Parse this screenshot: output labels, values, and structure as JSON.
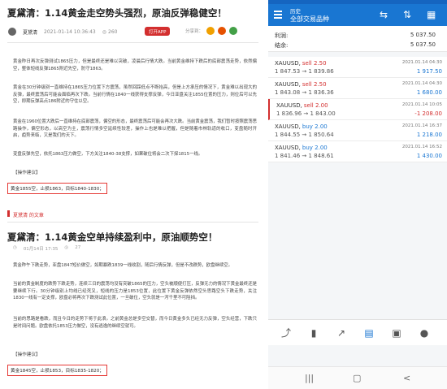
{
  "article1": {
    "title": "夏黛清：1.14黄金走空势头强烈，原油反弹稳健空！",
    "author": "夏黛清",
    "date": "2021-01-14 10:36:43",
    "views": "260",
    "app_button": "打开APP",
    "share_label": "分享到：",
    "paragraphs": [
      "黄金昨日再次反弹测试1865压力，但是最终还是难以突破，凌晨后行情大跌。当前黄金维持下跌后的底部震荡走势，依然偏空，整体短线反弹1865附近先空，防守1863。",
      "黄金在30分钟级别一直维持在1865压力位置下方震荡，虽然回踩低点不断抬高，但是上方承压的情况下，黄金难以出现大的反弹，最终震荡后可能会面临再次下跌。当前行情在1840一线获得支撑反弹，今日亚盘关注1855位置的压力，则位后可以先空，即期反弹高点186附近的守住以空。",
      "黄金在1960位置大跌后一直维持在底部震荡，偏空的形态，最终震荡后可能会再次大跌。当前黄金震荡，我们暂时按照震荡思路操作，偏空形态，以高空为主，震荡行情多空延续性较差，操作上也是难以把握，但是随着市林轨道的收口，变盘随时开启，趋势来临，又是我们的天下。",
      "原油方面：1840下方1840-38支撑，如果破位2二次下探1815一线。"
    ],
    "para4_full": "变盘反弹先空，依托1863压力做空，下方关注1840-38支撑，如果破位将会二次下探1815一线。",
    "op_label": "【操作建议】",
    "op_text": "黄金1855空，止损1863，目标1840-1830；"
  },
  "section_label": "夏黛清 的文章",
  "article2": {
    "title": "夏黛清：1.14黄金空单持续盈利中，原油顺势空！",
    "date": "01月14日 17:35",
    "views": "27",
    "paragraphs": [
      "黄金昨午下跌走势，亚盘1847短价做空，如期暴跌1839一线收割，随后行情反弹，但是不改跌势，欧盘继续空。",
      "当前的黄金制度的跌势下跌走势，连续三日的震荡均没有突破1865的压力，空头被顺便打压，反弹无力的情况下黄金最终还是要继续下行。30分钟级别上均线已经死叉，短线的压力是1853位置，此位置下黄金反弹依然空头思路空头下跌走势，关注1830一线有一定支撑，欧盘必将再次下跌测试此位置，一旦破位，空头就是一泻千里不可阻挡。",
      "当前的思路是看跌，而且今日的走势下将于此浪。之前黄金总是多空交替，而今日黄金多头已经无力反弹，空头经营，下跌只是时间问题。欧盘依托1853压力做空，没有逃逸的继续空就可。"
    ],
    "op_label": "【操作建议】",
    "op_text": "黄金1845空，止损1853，目标1835-1820；"
  },
  "trade": {
    "statusbar_color": "#1565c0",
    "appbar_color": "#1976d2",
    "header_subtitle": "历史",
    "header_title": "全部交易品种",
    "icons": [
      "menu-icon",
      "swap-dollar-icon",
      "sort-icon",
      "calendar-icon"
    ],
    "summary": [
      {
        "label": "利润:",
        "value": "5 037.50"
      },
      {
        "label": "结余:",
        "value": "5 037.50"
      }
    ],
    "positions": [
      {
        "symbol": "XAUUSD,",
        "side": "sell 2.50",
        "dir": "sell",
        "price": "1 847.53 → 1 839.86",
        "time": "2021.01.14 04:30",
        "pl": "1 917.50",
        "pl_type": "gain"
      },
      {
        "symbol": "XAUUSD,",
        "side": "sell 2.50",
        "dir": "sell",
        "price": "1 843.08 → 1 836.36",
        "time": "2021.01.14 04:30",
        "pl": "1 680.00",
        "pl_type": "gain"
      },
      {
        "symbol": "XAUUSD,",
        "side": "sell 2.00",
        "dir": "sell",
        "price": "1 836.96 → 1 843.00",
        "time": "2021.01.14 10:05",
        "pl": "-1 208.00",
        "pl_type": "loss"
      },
      {
        "symbol": "XAUUSD,",
        "side": "buy 2.00",
        "dir": "buy",
        "price": "1 844.55 → 1 850.64",
        "time": "2021.01.14 16:37",
        "pl": "1 218.00",
        "pl_type": "gain"
      },
      {
        "symbol": "XAUUSD,",
        "side": "buy 2.00",
        "dir": "buy",
        "price": "1 841.46 → 1 848.61",
        "time": "2021.01.14 16:52",
        "pl": "1 430.00",
        "pl_type": "gain"
      }
    ],
    "gain_color": "#1976d2",
    "loss_color": "#d32f2f",
    "bottom_icons": [
      "trade-icon",
      "candles-icon",
      "chart-icon",
      "history-icon",
      "news-icon",
      "chat-icon"
    ],
    "nav_icons": [
      "back-icon",
      "home-icon",
      "recents-icon"
    ],
    "watermark": "盛世"
  }
}
